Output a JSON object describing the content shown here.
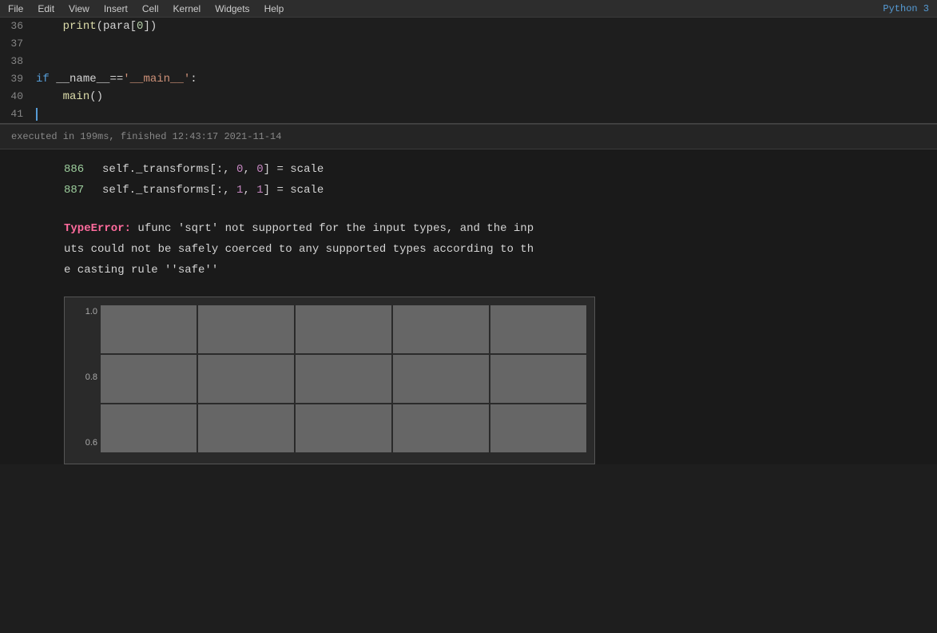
{
  "menubar": {
    "items": [
      "File",
      "Edit",
      "View",
      "Insert",
      "Cell",
      "Kernel",
      "Widgets",
      "Help"
    ],
    "logo": "Python 3"
  },
  "code_editor": {
    "lines": [
      {
        "number": "36",
        "tokens": [
          {
            "text": "    ",
            "class": ""
          },
          {
            "text": "print",
            "class": "kw-yellow"
          },
          {
            "text": "(para[",
            "class": "kw-white"
          },
          {
            "text": "0",
            "class": "kw-green"
          },
          {
            "text": "])",
            "class": "kw-white"
          }
        ]
      },
      {
        "number": "37",
        "tokens": []
      },
      {
        "number": "38",
        "tokens": []
      },
      {
        "number": "39",
        "tokens": [
          {
            "text": "if ",
            "class": "kw-blue"
          },
          {
            "text": "__name__",
            "class": "kw-white"
          },
          {
            "text": "==",
            "class": "kw-white"
          },
          {
            "text": "'__main__'",
            "class": "kw-orange"
          },
          {
            "text": ":",
            "class": "kw-white"
          }
        ]
      },
      {
        "number": "40",
        "tokens": [
          {
            "text": "    ",
            "class": ""
          },
          {
            "text": "main",
            "class": "kw-yellow"
          },
          {
            "text": "()",
            "class": "kw-white"
          }
        ]
      },
      {
        "number": "41",
        "tokens": [],
        "cursor": true
      }
    ]
  },
  "execution": {
    "info": "executed in 199ms, finished 12:43:17 2021-11-14",
    "output_lines": [
      {
        "number": "886",
        "tokens": [
          {
            "text": "self.",
            "class": "kw-white"
          },
          {
            "text": "_transforms",
            "class": "kw-white"
          },
          {
            "text": "[:, ",
            "class": "kw-white"
          },
          {
            "text": "0",
            "class": "kw-purple"
          },
          {
            "text": ", ",
            "class": "kw-white"
          },
          {
            "text": "0",
            "class": "kw-purple"
          },
          {
            "text": "] ",
            "class": "kw-white"
          },
          {
            "text": "= ",
            "class": "kw-white"
          },
          {
            "text": "scale",
            "class": "kw-white"
          }
        ]
      },
      {
        "number": "887",
        "tokens": [
          {
            "text": "self.",
            "class": "kw-white"
          },
          {
            "text": "_transforms",
            "class": "kw-white"
          },
          {
            "text": "[:, ",
            "class": "kw-white"
          },
          {
            "text": "1",
            "class": "kw-purple"
          },
          {
            "text": ", ",
            "class": "kw-white"
          },
          {
            "text": "1",
            "class": "kw-purple"
          },
          {
            "text": "] ",
            "class": "kw-white"
          },
          {
            "text": "= ",
            "class": "kw-white"
          },
          {
            "text": "scale",
            "class": "kw-white"
          }
        ]
      }
    ],
    "error": {
      "keyword": "TypeError:",
      "message": " ufunc 'sqrt' not supported for the input types, and the inputs could not be safely coerced to any supported types according to the casting rule ''safe''"
    }
  },
  "chart": {
    "y_labels": [
      "1.0",
      "0.8",
      "0.6"
    ],
    "grid_rows": 3,
    "grid_cols": 5
  }
}
